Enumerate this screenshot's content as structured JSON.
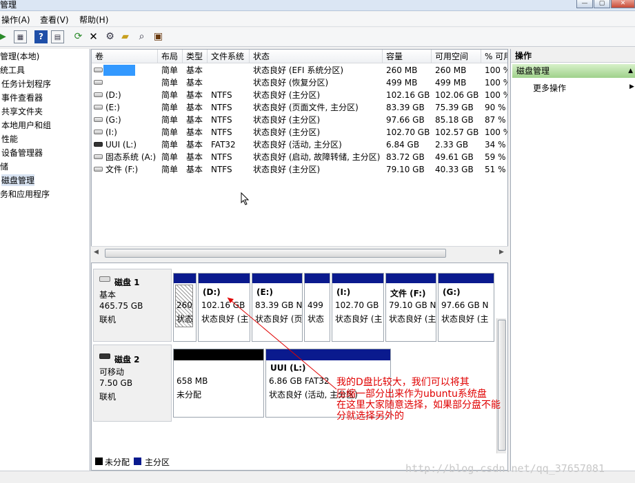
{
  "window": {
    "title": "管理"
  },
  "menu": [
    "操作(A)",
    "查看(V)",
    "帮助(H)"
  ],
  "toolbar_icons": [
    "back-icon",
    "forward-icon",
    "console-tree-icon",
    "help-icon",
    "properties-icon",
    "refresh-icon",
    "delete-icon",
    "settings-icon",
    "open-folder-icon",
    "search-icon",
    "rescan-icon"
  ],
  "tree": [
    "管理(本地)",
    "统工具",
    "任务计划程序",
    "事件查看器",
    "共享文件夹",
    "本地用户和组",
    "性能",
    "设备管理器",
    "储",
    "磁盘管理",
    "务和应用程序"
  ],
  "volume_table": {
    "columns": [
      "卷",
      "布局",
      "类型",
      "文件系统",
      "状态",
      "容量",
      "可用空间",
      "% 可用"
    ],
    "rows": [
      {
        "name": "",
        "layout": "简单",
        "type": "基本",
        "fs": "",
        "status": "状态良好 (EFI 系统分区)",
        "capacity": "260 MB",
        "free": "260 MB",
        "pct": "100 %"
      },
      {
        "name": "",
        "layout": "简单",
        "type": "基本",
        "fs": "",
        "status": "状态良好 (恢复分区)",
        "capacity": "499 MB",
        "free": "499 MB",
        "pct": "100 %"
      },
      {
        "name": "(D:)",
        "layout": "简单",
        "type": "基本",
        "fs": "NTFS",
        "status": "状态良好 (主分区)",
        "capacity": "102.16 GB",
        "free": "102.06 GB",
        "pct": "100 %"
      },
      {
        "name": "(E:)",
        "layout": "简单",
        "type": "基本",
        "fs": "NTFS",
        "status": "状态良好 (页面文件, 主分区)",
        "capacity": "83.39 GB",
        "free": "75.39 GB",
        "pct": "90 %"
      },
      {
        "name": "(G:)",
        "layout": "简单",
        "type": "基本",
        "fs": "NTFS",
        "status": "状态良好 (主分区)",
        "capacity": "97.66 GB",
        "free": "85.18 GB",
        "pct": "87 %"
      },
      {
        "name": "(I:)",
        "layout": "简单",
        "type": "基本",
        "fs": "NTFS",
        "status": "状态良好 (主分区)",
        "capacity": "102.70 GB",
        "free": "102.57 GB",
        "pct": "100 %"
      },
      {
        "name": "UUI (L:)",
        "layout": "简单",
        "type": "基本",
        "fs": "FAT32",
        "status": "状态良好 (活动, 主分区)",
        "capacity": "6.84 GB",
        "free": "2.33 GB",
        "pct": "34 %"
      },
      {
        "name": "固态系统 (A:)",
        "layout": "简单",
        "type": "基本",
        "fs": "NTFS",
        "status": "状态良好 (启动, 故障转储, 主分区)",
        "capacity": "83.72 GB",
        "free": "49.61 GB",
        "pct": "59 %"
      },
      {
        "name": "文件 (F:)",
        "layout": "简单",
        "type": "基本",
        "fs": "NTFS",
        "status": "状态良好 (主分区)",
        "capacity": "79.10 GB",
        "free": "40.33 GB",
        "pct": "51 %"
      }
    ]
  },
  "disks": [
    {
      "label": "磁盘 1",
      "kind": "基本",
      "size": "465.75 GB",
      "state": "联机",
      "partitions": [
        {
          "title": "",
          "size": "260",
          "status": "状态"
        },
        {
          "title": "(D:)",
          "size": "102.16 GB",
          "status": "状态良好 (主"
        },
        {
          "title": "(E:)",
          "size": "83.39 GB N",
          "status": "状态良好 (页"
        },
        {
          "title": "",
          "size": "499",
          "status": "状态"
        },
        {
          "title": "(I:)",
          "size": "102.70 GB",
          "status": "状态良好 (主"
        },
        {
          "title": "文件  (F:)",
          "size": "79.10 GB N",
          "status": "状态良好 (主"
        },
        {
          "title": "(G:)",
          "size": "97.66 GB N",
          "status": "状态良好 (主"
        }
      ]
    },
    {
      "label": "磁盘 2",
      "kind": "可移动",
      "size": "7.50 GB",
      "state": "联机",
      "partitions": [
        {
          "title": "",
          "size": "658 MB",
          "status": "未分配"
        },
        {
          "title": "UUI  (L:)",
          "size": "6.86 GB FAT32",
          "status": "状态良好 (活动, 主分区)"
        }
      ]
    }
  ],
  "legend": [
    "未分配",
    "主分区"
  ],
  "legend_colors": [
    "#000000",
    "#0a1a8e"
  ],
  "actions": {
    "header": "操作",
    "section": "磁盘管理",
    "more": "更多操作"
  },
  "annotation": [
    "我的D盘比较大，我们可以将其",
    "压缩一部分出来作为ubuntu系统盘",
    "在这里大家随意选择，如果部分盘不能",
    "分就选择另外的"
  ],
  "watermark": "http://blog.csdn.net/qq_37657081"
}
